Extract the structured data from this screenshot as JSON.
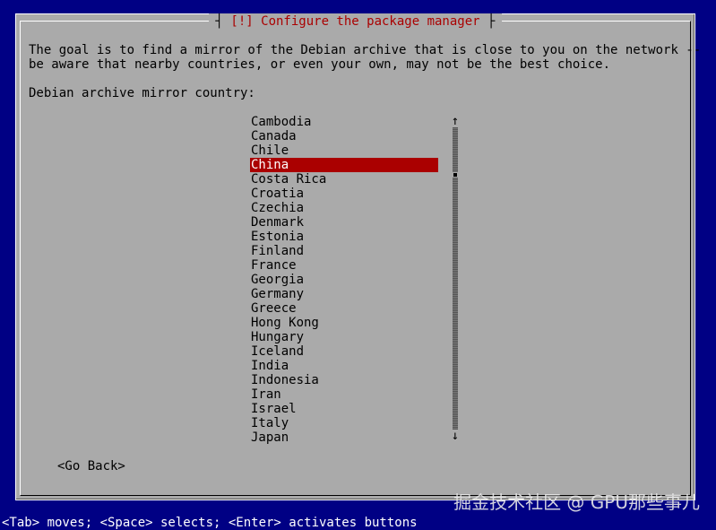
{
  "dialog": {
    "title_prefix": "[!]",
    "title_text": " Configure the package manager",
    "description_line1": "The goal is to find a mirror of the Debian archive that is close to you on the network --",
    "description_line2": "be aware that nearby countries, or even your own, may not be the best choice.",
    "prompt": "Debian archive mirror country:",
    "countries": [
      "Cambodia",
      "Canada",
      "Chile",
      "China",
      "Costa Rica",
      "Croatia",
      "Czechia",
      "Denmark",
      "Estonia",
      "Finland",
      "France",
      "Georgia",
      "Germany",
      "Greece",
      "Hong Kong",
      "Hungary",
      "Iceland",
      "India",
      "Indonesia",
      "Iran",
      "Israel",
      "Italy",
      "Japan"
    ],
    "selected_country": "China",
    "scroll_up_glyph": "↑",
    "scroll_down_glyph": "↓",
    "go_back_label": "<Go Back>"
  },
  "status_bar": {
    "text": "<Tab> moves; <Space> selects; <Enter> activates buttons"
  },
  "watermark": {
    "text": "掘金技术社区 @ GPU那些事儿"
  },
  "colors": {
    "background": "#000084",
    "dialog": "#aaaaaa",
    "title": "#aa0000",
    "selection": "#aa0000",
    "selection_text": "#ffffff"
  }
}
